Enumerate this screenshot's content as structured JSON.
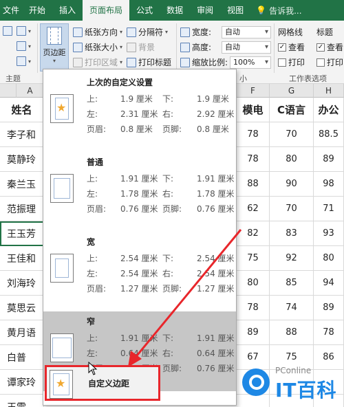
{
  "tabs": [
    {
      "label": "文件"
    },
    {
      "label": "开始"
    },
    {
      "label": "插入"
    },
    {
      "label": "页面布局"
    },
    {
      "label": "公式"
    },
    {
      "label": "数据"
    },
    {
      "label": "审阅"
    },
    {
      "label": "视图"
    }
  ],
  "tell_me": "告诉我...",
  "ribbon": {
    "theme_group": "主题",
    "margins_label": "页边距",
    "orientation": "纸张方向",
    "size": "纸张大小",
    "print_area": "打印区域",
    "breaks": "分隔符",
    "background": "背景",
    "print_titles": "打印标题",
    "width_label": "宽度:",
    "width_value": "自动",
    "height_label": "高度:",
    "height_value": "自动",
    "scale_label": "缩放比例:",
    "scale_value": "100%",
    "scale_group_suffix": "小",
    "gridlines": "网格线",
    "headings": "标题",
    "view1": "查看",
    "view2": "查看",
    "print1": "打印",
    "print2": "打印",
    "sheet_options": "工作表选项"
  },
  "sheet": {
    "columns": [
      "A",
      "F",
      "G",
      "H"
    ],
    "header_row": [
      "姓名",
      "模电",
      "C语言",
      "办公"
    ],
    "rows": [
      {
        "name": "李子和",
        "f": "78",
        "g": "70",
        "h": "88.5"
      },
      {
        "name": "莫静玲",
        "f": "78",
        "g": "80",
        "h": "89"
      },
      {
        "name": "秦兰玉",
        "f": "88",
        "g": "90",
        "h": "98"
      },
      {
        "name": "范振理",
        "f": "62",
        "g": "70",
        "h": "71"
      },
      {
        "name": "王玉芳",
        "f": "82",
        "g": "83",
        "h": "93"
      },
      {
        "name": "王佳和",
        "f": "75",
        "g": "92",
        "h": "80"
      },
      {
        "name": "刘海玲",
        "f": "80",
        "g": "85",
        "h": "94"
      },
      {
        "name": "莫思云",
        "f": "78",
        "g": "74",
        "h": "89"
      },
      {
        "name": "黄月语",
        "f": "89",
        "g": "88",
        "h": "78"
      },
      {
        "name": "白普",
        "f": "67",
        "g": "75",
        "h": "86"
      },
      {
        "name": "谭家玲",
        "f": "",
        "g": "",
        "h": ""
      },
      {
        "name": "王雷",
        "f": "",
        "g": "",
        "h": ""
      }
    ]
  },
  "margins": {
    "presets": [
      {
        "title": "上次的自定义设置",
        "top_l": "上:",
        "top_v": "1.9 厘米",
        "bottom_l": "下:",
        "bottom_v": "1.9 厘米",
        "left_l": "左:",
        "left_v": "2.31 厘米",
        "right_l": "右:",
        "right_v": "2.92 厘米",
        "header_l": "页眉:",
        "header_v": "0.8 厘米",
        "footer_l": "页脚:",
        "footer_v": "0.8 厘米"
      },
      {
        "title": "普通",
        "top_l": "上:",
        "top_v": "1.91 厘米",
        "bottom_l": "下:",
        "bottom_v": "1.91 厘米",
        "left_l": "左:",
        "left_v": "1.78 厘米",
        "right_l": "右:",
        "right_v": "1.78 厘米",
        "header_l": "页眉:",
        "header_v": "0.76 厘米",
        "footer_l": "页脚:",
        "footer_v": "0.76 厘米"
      },
      {
        "title": "宽",
        "top_l": "上:",
        "top_v": "2.54 厘米",
        "bottom_l": "下:",
        "bottom_v": "2.54 厘米",
        "left_l": "左:",
        "left_v": "2.54 厘米",
        "right_l": "右:",
        "right_v": "2.54 厘米",
        "header_l": "页眉:",
        "header_v": "1.27 厘米",
        "footer_l": "页脚:",
        "footer_v": "1.27 厘米"
      },
      {
        "title": "窄",
        "top_l": "上:",
        "top_v": "1.91 厘米",
        "bottom_l": "下:",
        "bottom_v": "1.91 厘米",
        "left_l": "左:",
        "left_v": "0.64 厘米",
        "right_l": "右:",
        "right_v": "0.64 厘米",
        "header_l": "页眉:",
        "header_v": "0.76 厘米",
        "footer_l": "页脚:",
        "footer_v": "0.76 厘米"
      }
    ],
    "custom_label": "自定义边距"
  },
  "watermark": {
    "small": "PConline",
    "big": "IT百科"
  },
  "colors": {
    "accent": "#217346",
    "highlight_border": "#e8262b",
    "arrow": "#e8262b",
    "watermark": "#1e88e5"
  }
}
